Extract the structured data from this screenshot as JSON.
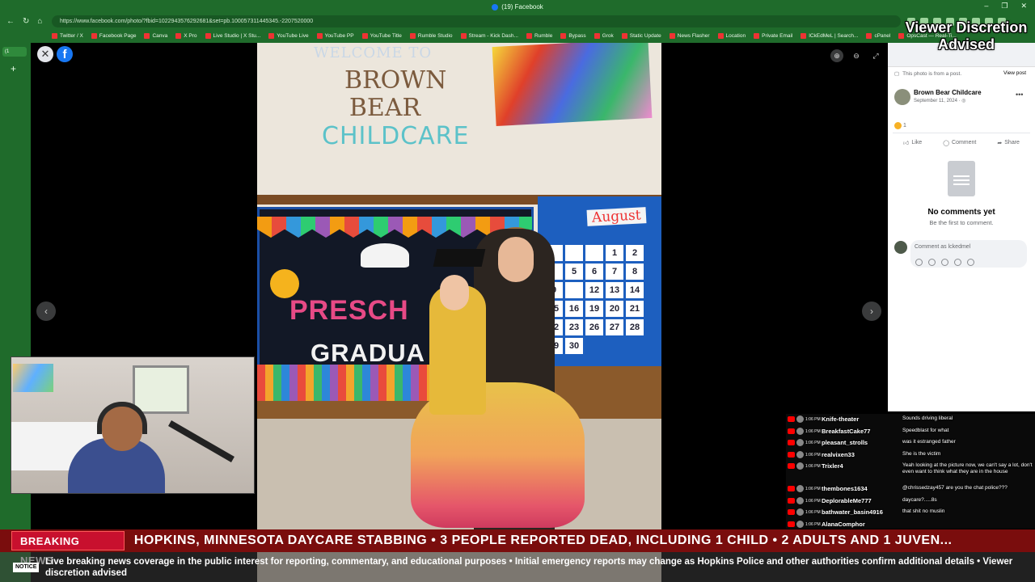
{
  "browser": {
    "tab_title": "(19) Facebook",
    "url": "https://www.facebook.com/photo/?fbid=1022943576292681&set=pb.100057311445345.-2207520000",
    "bookmarks": [
      "Twitter / X",
      "Facebook Page",
      "Canva",
      "X Pro",
      "Live Studio | X Stu...",
      "YouTube Live",
      "YouTube PP",
      "YouTube Title",
      "Rumble Studio",
      "Stream - Kick Dash...",
      "Rumble",
      "Bypass",
      "Grok",
      "Static Update",
      "News Flasher",
      "Location",
      "Private Email",
      "lCkEdMeL | Search...",
      "cPanel",
      "OpsCast — Real-Ti..."
    ],
    "side_tab_label": "(1"
  },
  "overlay": {
    "discretion_line1": "Viewer Discretion",
    "discretion_line2": "Advised"
  },
  "photo": {
    "welcome_text": "WELCOME TO",
    "sign_line1": "BROWN",
    "sign_line2": "BEAR",
    "sign_line3": "CHILDCARE",
    "board_text1": "PRESCH",
    "board_text2": "GRADUA",
    "calendar_month": "August",
    "calendar_days": [
      "",
      "",
      "",
      "1",
      "2",
      "",
      "5",
      "6",
      "7",
      "8",
      "9",
      "",
      "12",
      "13",
      "14",
      "15",
      "16",
      "19",
      "20",
      "21",
      "22",
      "23",
      "26",
      "27",
      "28",
      "29",
      "30"
    ]
  },
  "panel": {
    "from_post": "This photo is from a post.",
    "view_post": "View post",
    "page_name": "Brown Bear Childcare",
    "post_date": "September 11, 2024 · ",
    "reaction_count": "1",
    "like": "Like",
    "comment": "Comment",
    "share": "Share",
    "no_comments_title": "No comments yet",
    "no_comments_sub": "Be the first to comment.",
    "comment_placeholder": "Comment as lckedmel"
  },
  "chat": [
    {
      "time": "1:06 PM",
      "user": "Knife-theater",
      "msg": "Sounds driving liberal"
    },
    {
      "time": "1:06 PM",
      "user": "BreakfastCake77",
      "msg": "Speedblast for what"
    },
    {
      "time": "1:06 PM",
      "user": "pleasant_strolls",
      "msg": "was it estranged father"
    },
    {
      "time": "1:06 PM",
      "user": "realvixen33",
      "msg": "She is the victim"
    },
    {
      "time": "1:06 PM",
      "user": "Trixler4",
      "msg": "Yeah looking at the picture now, we can't say a lot, don't even want to think what they are in the house"
    },
    {
      "time": "1:06 PM",
      "user": "thembones1634",
      "msg": "@chrissedzay457 are you the chat police???"
    },
    {
      "time": "1:06 PM",
      "user": "DeplorableMe777",
      "msg": "daycare?.....8s"
    },
    {
      "time": "1:06 PM",
      "user": "bathwater_basin4916",
      "msg": "that shit no muslin"
    },
    {
      "time": "1:06 PM",
      "user": "AlanaComphor",
      "msg": ""
    }
  ],
  "ticker": {
    "label": "BREAKING NEWS",
    "headline": "HOPKINS, MINNESOTA DAYCARE STABBING • 3 PEOPLE REPORTED DEAD, INCLUDING 1 CHILD • 2 ADULTS AND 1 JUVEN...",
    "notice_label": "NOTICE",
    "notice_text": "Live breaking news coverage in the public interest for reporting, commentary, and educational purposes • Initial emergency reports may change as Hopkins Police and other authorities confirm additional details • Viewer discretion advised"
  }
}
